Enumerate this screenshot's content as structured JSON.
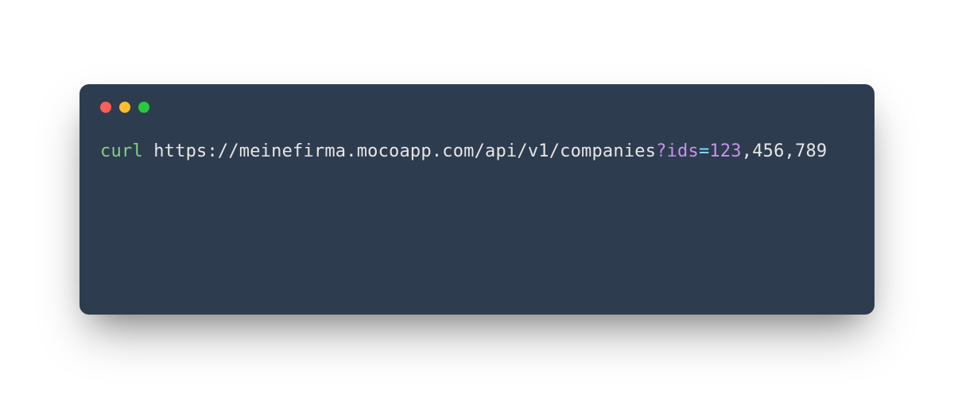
{
  "terminal": {
    "command": "curl",
    "url": "https://meinefirma.mocoapp.com/api/v1/companies",
    "qmark": "?",
    "param": "ids",
    "eq": "=",
    "val1": "123",
    "comma1": ",",
    "val2": "456",
    "comma2": ",",
    "val3": "789"
  },
  "colors": {
    "bg": "#2e3c4f",
    "cmd": "#7fd17f",
    "url": "#e6e6e6",
    "param": "#c792ea",
    "eq": "#89ddff"
  }
}
